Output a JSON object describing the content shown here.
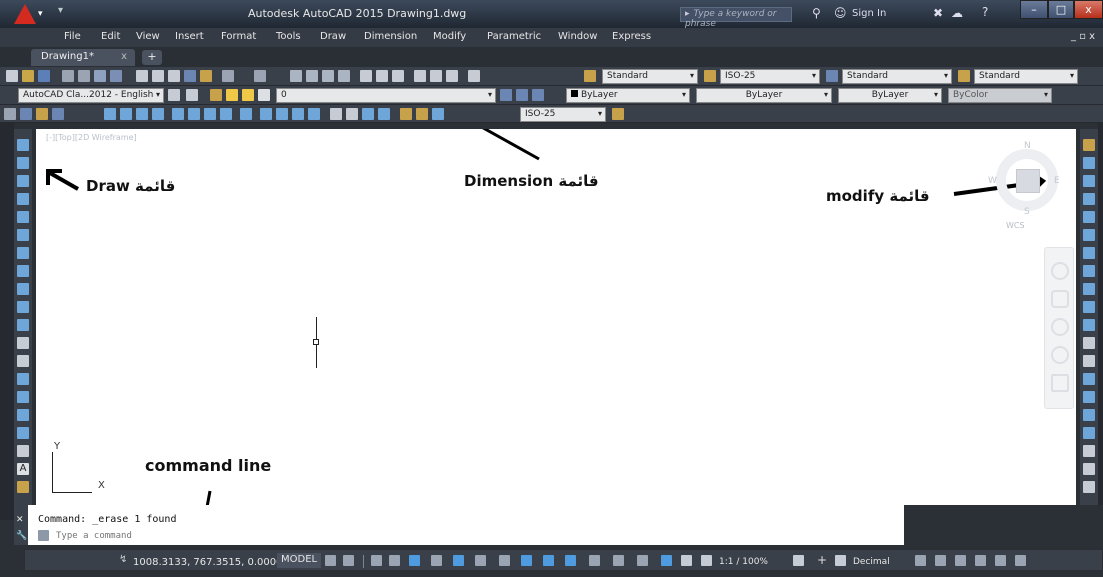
{
  "window": {
    "title": "Autodesk AutoCAD 2015    Drawing1.dwg",
    "search_placeholder": "Type a keyword or phrase",
    "sign_in": "Sign In"
  },
  "menu": [
    "File",
    "Edit",
    "View",
    "Insert",
    "Format",
    "Tools",
    "Draw",
    "Dimension",
    "Modify",
    "Parametric",
    "Window",
    "Express"
  ],
  "doc_controls": "_ ▫ x",
  "tabs": {
    "active": "Drawing1*",
    "close": "x",
    "plus": "+"
  },
  "toolbar1": {
    "text_style": "Standard",
    "dim_style": "ISO-25",
    "table_style": "Standard",
    "mleader_style": "Standard"
  },
  "toolbar2": {
    "workspace": "AutoCAD Cla...2012 - English",
    "layer": "0",
    "color": "ByLayer",
    "linetype": "ByLayer",
    "lineweight": "ByLayer",
    "plotstyle": "ByColor"
  },
  "toolbar3": {
    "dim_style_current": "ISO-25"
  },
  "canvas": {
    "view_label": "[-][Top][2D Wireframe]",
    "viewcube": {
      "N": "N",
      "S": "S",
      "E": "E",
      "W": "W",
      "wcs": "WCS"
    },
    "ucs": {
      "x": "X",
      "y": "Y"
    }
  },
  "annotations": {
    "draw": "قائمة Draw",
    "dimension": "قائمة Dimension",
    "modify": "قائمة modify",
    "command_line": "command line"
  },
  "command": {
    "history": "Command: _erase 1 found",
    "placeholder": "Type a command"
  },
  "status": {
    "coords": "1008.3133, 767.3515, 0.0000",
    "model": "MODEL",
    "scale": "1:1 / 100%",
    "units": "Decimal"
  },
  "colors": {
    "accent_red": "#d42a20",
    "ui_dark": "#3a4049",
    "canvas_bg": "#ffffff"
  }
}
